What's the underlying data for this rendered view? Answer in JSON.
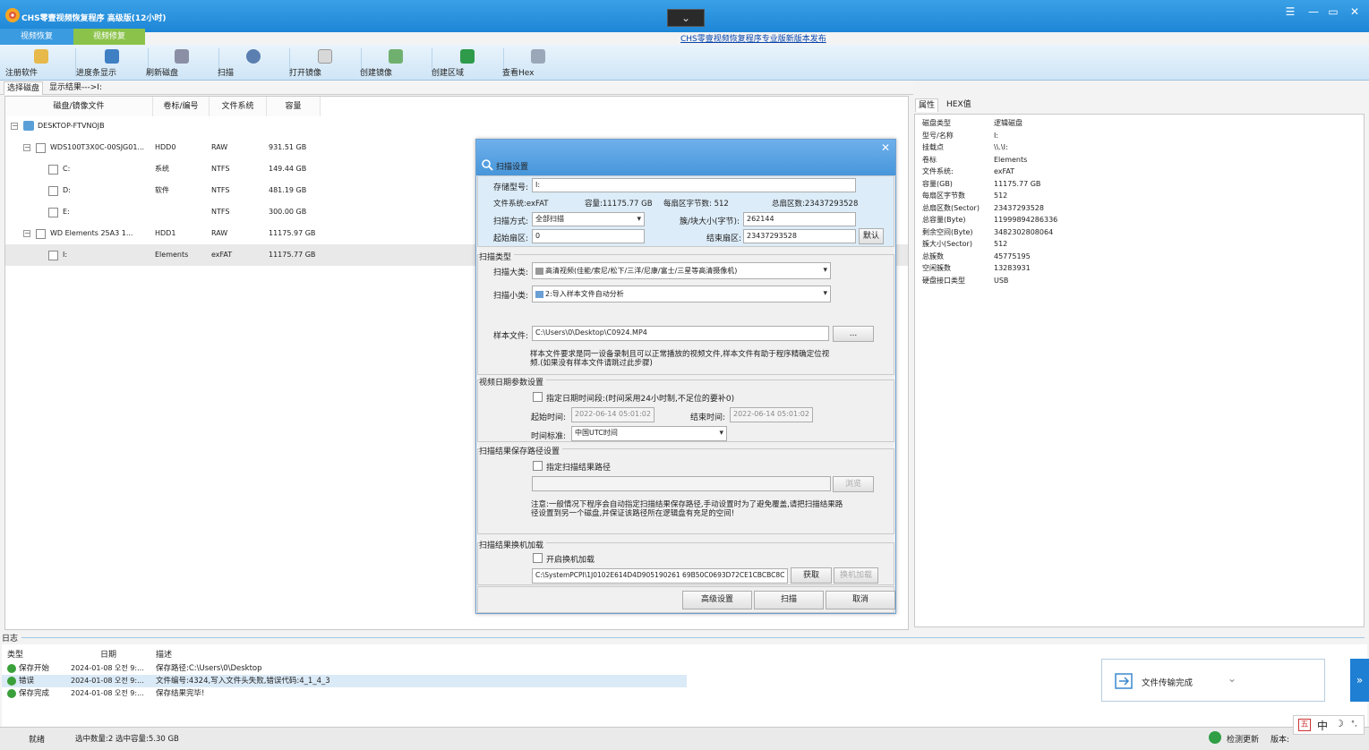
{
  "window": {
    "title": "CHS零壹视频恢复程序 高级版(12小时)",
    "notice_link": "CHS零壹视频恢复程序专业版新版本发布",
    "collapse": "⌄"
  },
  "tabs": {
    "recover": "视频恢复",
    "repair": "视频修复"
  },
  "toolbar": [
    "注册软件",
    "进度条显示",
    "刷新磁盘",
    "扫描",
    "打开镜像",
    "创建镜像",
    "创建区域",
    "查看Hex"
  ],
  "subtabs": {
    "select_disk": "选择磁盘",
    "show_results": "显示结果--->I:"
  },
  "disk_table": {
    "headers": [
      "磁盘/镜像文件",
      "卷标/编号",
      "文件系统",
      "容量"
    ],
    "rows": [
      {
        "name": "DESKTOP-FTVNOJB",
        "label": "",
        "fs": "",
        "size": ""
      },
      {
        "name": "WDS100T3X0C-00SJG01...",
        "label": "HDD0",
        "fs": "RAW",
        "size": "931.51 GB"
      },
      {
        "name": "C:",
        "label": "系统",
        "fs": "NTFS",
        "size": "149.44 GB"
      },
      {
        "name": "D:",
        "label": "软件",
        "fs": "NTFS",
        "size": "481.19 GB"
      },
      {
        "name": "E:",
        "label": "",
        "fs": "NTFS",
        "size": "300.00 GB"
      },
      {
        "name": "WD     Elements 25A3   1...",
        "label": "HDD1",
        "fs": "RAW",
        "size": "11175.97 GB"
      },
      {
        "name": "I:",
        "label": "Elements",
        "fs": "exFAT",
        "size": "11175.77 GB"
      }
    ]
  },
  "right_tabs": {
    "props": "属性",
    "hex": "HEX值"
  },
  "properties": [
    [
      "磁盘类型",
      "逻辑磁盘"
    ],
    [
      "型号/名称",
      "I:"
    ],
    [
      "挂载点",
      "\\\\.\\I:"
    ],
    [
      "卷标",
      "Elements"
    ],
    [
      "文件系统:",
      "exFAT"
    ],
    [
      "容量(GB)",
      "11175.77 GB"
    ],
    [
      "每扇区字节数",
      "512"
    ],
    [
      "总扇区数(Sector)",
      "23437293528"
    ],
    [
      "总容量(Byte)",
      "11999894286336"
    ],
    [
      "剩余空间(Byte)",
      "3482302808064"
    ],
    [
      "簇大小(Sector)",
      "512"
    ],
    [
      "总簇数",
      "45775195"
    ],
    [
      "空闲簇数",
      "13283931"
    ],
    [
      "硬盘接口类型",
      "USB"
    ]
  ],
  "dialog": {
    "title": "扫描设置",
    "close": "✕",
    "storage_label": "存储型号:",
    "storage_value": "I:",
    "fs_info": "文件系统:exFAT",
    "cap_info": "容量:11175.77 GB",
    "bps_info": "每扇区字节数: 512",
    "total_info": "总扇区数:23437293528",
    "scan_mode_label": "扫描方式:",
    "scan_mode": "全部扫描",
    "cluster_label": "簇/块大小(字节):",
    "cluster_value": "262144",
    "start_label": "起始扇区:",
    "start_value": "0",
    "end_label": "结束扇区:",
    "end_value": "23437293528",
    "default_btn": "默认",
    "scan_type_header": "扫描类型",
    "major_label": "扫描大类:",
    "major_value": "高清视频(佳能/索尼/松下/三洋/尼康/富士/三星等高清摄像机)",
    "minor_label": "扫描小类:",
    "minor_value": "2:导入样本文件自动分析",
    "sample_label": "样本文件:",
    "sample_value": "C:\\Users\\0\\Desktop\\C0924.MP4",
    "browse_dots": "...",
    "sample_note": "样本文件要求是同一设备录制且可以正常播放的视频文件,样本文件有助于程序精确定位视频.(如果没有样本文件请跳过此步骤)",
    "date_header": "视频日期参数设置",
    "date_check": "指定日期时间段:(时间采用24小时制,不足位的要补0)",
    "date_start_label": "起始时间:",
    "date_start": "2022-06-14 05:01:02",
    "date_end_label": "结束时间:",
    "date_end": "2022-06-14 05:01:02",
    "tz_label": "时间标准:",
    "tz_value": "中国UTC时间",
    "path_header": "扫描结果保存路径设置",
    "path_check": "指定扫描结果路径",
    "path_browse": "浏览",
    "path_note": "注意:一般情况下程序会自动指定扫描结果保存路径,手动设置时为了避免覆盖,请把扫描结果路径设置到另一个磁盘,并保证该路径所在逻辑盘有充足的空间!",
    "load_header": "扫描结果换机加载",
    "load_check": "开启换机加载",
    "load_path": "C:\\SystemPCPI\\1J0102E614D4D905190261 69B50C0693D72CE1CBCBC8C",
    "get_btn": "获取",
    "load_btn": "换机加载",
    "advanced_btn": "高级设置",
    "scan_btn": "扫描",
    "cancel_btn": "取消"
  },
  "log": {
    "label": "日志",
    "headers": [
      "类型",
      "日期",
      "描述"
    ],
    "rows": [
      {
        "type": "保存开始",
        "date": "2024-01-08 오전 9:...",
        "desc": "保存路径:C:\\Users\\0\\Desktop",
        "color": "#3aa03a"
      },
      {
        "type": "错误",
        "date": "2024-01-08 오전 9:...",
        "desc": "文件编号:4324,写入文件头失败,错误代码:4_1_4_3",
        "color": "#3aa03a"
      },
      {
        "type": "保存完成",
        "date": "2024-01-08 오전 9:...",
        "desc": "保存结果完毕!",
        "color": "#3aa03a"
      }
    ]
  },
  "status": {
    "ready": "就绪",
    "selection": "选中数量:2 选中容量:5.30 GB",
    "check_update": "检测更新",
    "version_label": "版本:"
  },
  "toast": {
    "text": "文件传输完成"
  },
  "ime": {
    "zh": "中"
  }
}
